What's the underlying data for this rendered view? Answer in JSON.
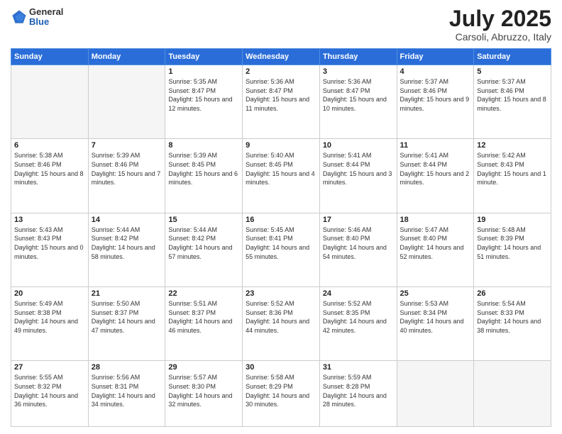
{
  "header": {
    "logo": {
      "general": "General",
      "blue": "Blue"
    },
    "title": "July 2025",
    "location": "Carsoli, Abruzzo, Italy"
  },
  "weekdays": [
    "Sunday",
    "Monday",
    "Tuesday",
    "Wednesday",
    "Thursday",
    "Friday",
    "Saturday"
  ],
  "weeks": [
    [
      {
        "day": "",
        "sunrise": "",
        "sunset": "",
        "daylight": "",
        "empty": true
      },
      {
        "day": "",
        "sunrise": "",
        "sunset": "",
        "daylight": "",
        "empty": true
      },
      {
        "day": "1",
        "sunrise": "Sunrise: 5:35 AM",
        "sunset": "Sunset: 8:47 PM",
        "daylight": "Daylight: 15 hours and 12 minutes.",
        "empty": false
      },
      {
        "day": "2",
        "sunrise": "Sunrise: 5:36 AM",
        "sunset": "Sunset: 8:47 PM",
        "daylight": "Daylight: 15 hours and 11 minutes.",
        "empty": false
      },
      {
        "day": "3",
        "sunrise": "Sunrise: 5:36 AM",
        "sunset": "Sunset: 8:47 PM",
        "daylight": "Daylight: 15 hours and 10 minutes.",
        "empty": false
      },
      {
        "day": "4",
        "sunrise": "Sunrise: 5:37 AM",
        "sunset": "Sunset: 8:46 PM",
        "daylight": "Daylight: 15 hours and 9 minutes.",
        "empty": false
      },
      {
        "day": "5",
        "sunrise": "Sunrise: 5:37 AM",
        "sunset": "Sunset: 8:46 PM",
        "daylight": "Daylight: 15 hours and 8 minutes.",
        "empty": false
      }
    ],
    [
      {
        "day": "6",
        "sunrise": "Sunrise: 5:38 AM",
        "sunset": "Sunset: 8:46 PM",
        "daylight": "Daylight: 15 hours and 8 minutes.",
        "empty": false
      },
      {
        "day": "7",
        "sunrise": "Sunrise: 5:39 AM",
        "sunset": "Sunset: 8:46 PM",
        "daylight": "Daylight: 15 hours and 7 minutes.",
        "empty": false
      },
      {
        "day": "8",
        "sunrise": "Sunrise: 5:39 AM",
        "sunset": "Sunset: 8:45 PM",
        "daylight": "Daylight: 15 hours and 6 minutes.",
        "empty": false
      },
      {
        "day": "9",
        "sunrise": "Sunrise: 5:40 AM",
        "sunset": "Sunset: 8:45 PM",
        "daylight": "Daylight: 15 hours and 4 minutes.",
        "empty": false
      },
      {
        "day": "10",
        "sunrise": "Sunrise: 5:41 AM",
        "sunset": "Sunset: 8:44 PM",
        "daylight": "Daylight: 15 hours and 3 minutes.",
        "empty": false
      },
      {
        "day": "11",
        "sunrise": "Sunrise: 5:41 AM",
        "sunset": "Sunset: 8:44 PM",
        "daylight": "Daylight: 15 hours and 2 minutes.",
        "empty": false
      },
      {
        "day": "12",
        "sunrise": "Sunrise: 5:42 AM",
        "sunset": "Sunset: 8:43 PM",
        "daylight": "Daylight: 15 hours and 1 minute.",
        "empty": false
      }
    ],
    [
      {
        "day": "13",
        "sunrise": "Sunrise: 5:43 AM",
        "sunset": "Sunset: 8:43 PM",
        "daylight": "Daylight: 15 hours and 0 minutes.",
        "empty": false
      },
      {
        "day": "14",
        "sunrise": "Sunrise: 5:44 AM",
        "sunset": "Sunset: 8:42 PM",
        "daylight": "Daylight: 14 hours and 58 minutes.",
        "empty": false
      },
      {
        "day": "15",
        "sunrise": "Sunrise: 5:44 AM",
        "sunset": "Sunset: 8:42 PM",
        "daylight": "Daylight: 14 hours and 57 minutes.",
        "empty": false
      },
      {
        "day": "16",
        "sunrise": "Sunrise: 5:45 AM",
        "sunset": "Sunset: 8:41 PM",
        "daylight": "Daylight: 14 hours and 55 minutes.",
        "empty": false
      },
      {
        "day": "17",
        "sunrise": "Sunrise: 5:46 AM",
        "sunset": "Sunset: 8:40 PM",
        "daylight": "Daylight: 14 hours and 54 minutes.",
        "empty": false
      },
      {
        "day": "18",
        "sunrise": "Sunrise: 5:47 AM",
        "sunset": "Sunset: 8:40 PM",
        "daylight": "Daylight: 14 hours and 52 minutes.",
        "empty": false
      },
      {
        "day": "19",
        "sunrise": "Sunrise: 5:48 AM",
        "sunset": "Sunset: 8:39 PM",
        "daylight": "Daylight: 14 hours and 51 minutes.",
        "empty": false
      }
    ],
    [
      {
        "day": "20",
        "sunrise": "Sunrise: 5:49 AM",
        "sunset": "Sunset: 8:38 PM",
        "daylight": "Daylight: 14 hours and 49 minutes.",
        "empty": false
      },
      {
        "day": "21",
        "sunrise": "Sunrise: 5:50 AM",
        "sunset": "Sunset: 8:37 PM",
        "daylight": "Daylight: 14 hours and 47 minutes.",
        "empty": false
      },
      {
        "day": "22",
        "sunrise": "Sunrise: 5:51 AM",
        "sunset": "Sunset: 8:37 PM",
        "daylight": "Daylight: 14 hours and 46 minutes.",
        "empty": false
      },
      {
        "day": "23",
        "sunrise": "Sunrise: 5:52 AM",
        "sunset": "Sunset: 8:36 PM",
        "daylight": "Daylight: 14 hours and 44 minutes.",
        "empty": false
      },
      {
        "day": "24",
        "sunrise": "Sunrise: 5:52 AM",
        "sunset": "Sunset: 8:35 PM",
        "daylight": "Daylight: 14 hours and 42 minutes.",
        "empty": false
      },
      {
        "day": "25",
        "sunrise": "Sunrise: 5:53 AM",
        "sunset": "Sunset: 8:34 PM",
        "daylight": "Daylight: 14 hours and 40 minutes.",
        "empty": false
      },
      {
        "day": "26",
        "sunrise": "Sunrise: 5:54 AM",
        "sunset": "Sunset: 8:33 PM",
        "daylight": "Daylight: 14 hours and 38 minutes.",
        "empty": false
      }
    ],
    [
      {
        "day": "27",
        "sunrise": "Sunrise: 5:55 AM",
        "sunset": "Sunset: 8:32 PM",
        "daylight": "Daylight: 14 hours and 36 minutes.",
        "empty": false
      },
      {
        "day": "28",
        "sunrise": "Sunrise: 5:56 AM",
        "sunset": "Sunset: 8:31 PM",
        "daylight": "Daylight: 14 hours and 34 minutes.",
        "empty": false
      },
      {
        "day": "29",
        "sunrise": "Sunrise: 5:57 AM",
        "sunset": "Sunset: 8:30 PM",
        "daylight": "Daylight: 14 hours and 32 minutes.",
        "empty": false
      },
      {
        "day": "30",
        "sunrise": "Sunrise: 5:58 AM",
        "sunset": "Sunset: 8:29 PM",
        "daylight": "Daylight: 14 hours and 30 minutes.",
        "empty": false
      },
      {
        "day": "31",
        "sunrise": "Sunrise: 5:59 AM",
        "sunset": "Sunset: 8:28 PM",
        "daylight": "Daylight: 14 hours and 28 minutes.",
        "empty": false
      },
      {
        "day": "",
        "sunrise": "",
        "sunset": "",
        "daylight": "",
        "empty": true
      },
      {
        "day": "",
        "sunrise": "",
        "sunset": "",
        "daylight": "",
        "empty": true
      }
    ]
  ]
}
